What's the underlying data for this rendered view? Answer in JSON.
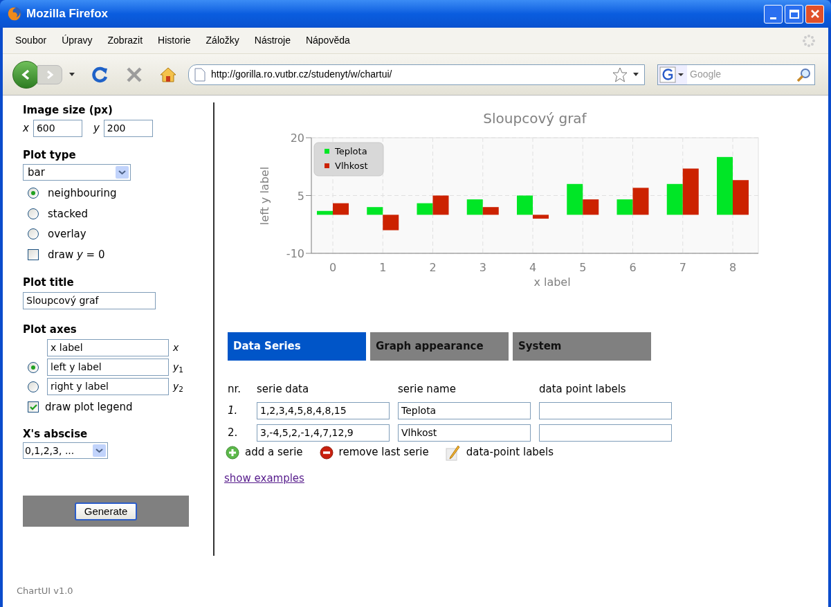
{
  "window": {
    "title": "Mozilla Firefox"
  },
  "menu": [
    "Soubor",
    "Úpravy",
    "Zobrazit",
    "Historie",
    "Záložky",
    "Nástroje",
    "Nápověda"
  ],
  "toolbar": {
    "url": "http://gorilla.ro.vutbr.cz/studenyt/w/chartui/",
    "search_placeholder": "Google"
  },
  "sidebar": {
    "image_size": {
      "heading": "Image size (px)",
      "x_label": "x",
      "x_value": "600",
      "y_label": "y",
      "y_value": "200"
    },
    "plot_type": {
      "heading": "Plot type",
      "select_value": "bar",
      "options": [
        {
          "label": "neighbouring",
          "selected": true
        },
        {
          "label": "stacked",
          "selected": false
        },
        {
          "label": "overlay",
          "selected": false
        }
      ],
      "draw_zero": {
        "label": "draw *y* = 0",
        "checked": false
      }
    },
    "plot_title": {
      "heading": "Plot title",
      "value": "Sloupcový graf"
    },
    "plot_axes": {
      "heading": "Plot axes",
      "fields": [
        {
          "kind": "plain",
          "value": "x label",
          "suffix": "*x*"
        },
        {
          "kind": "radio",
          "value": "left y label",
          "suffix": "*y*$_{1}$",
          "selected": true
        },
        {
          "kind": "radio",
          "value": "right y label",
          "suffix": "*y*$_{2}$",
          "selected": false
        }
      ],
      "legend": {
        "label": "draw plot legend",
        "checked": true
      }
    },
    "abscise": {
      "heading": "X's abscise",
      "value": "0,1,2,3, ..."
    },
    "generate": "Generate",
    "footer": "ChartUI v1.0"
  },
  "main": {
    "chart_data": {
      "type": "bar",
      "title": "Sloupcový graf",
      "xlabel": "x label",
      "ylabel": "left y label",
      "categories": [
        "0",
        "1",
        "2",
        "3",
        "4",
        "5",
        "6",
        "7",
        "8"
      ],
      "series": [
        {
          "name": "Teplota",
          "color": "#00e626",
          "values": [
            1,
            2,
            3,
            4,
            5,
            8,
            4,
            8,
            15
          ]
        },
        {
          "name": "Vlhkost",
          "color": "#cc2200",
          "values": [
            3,
            -4,
            5,
            2,
            -1,
            4,
            7,
            12,
            9
          ]
        }
      ],
      "ylim": [
        -10,
        20
      ],
      "yticks": [
        -10,
        5,
        20
      ],
      "grid": true,
      "legend": true
    },
    "tabs": [
      {
        "label": "Data Series",
        "selected": true
      },
      {
        "label": "Graph appearance",
        "selected": false
      },
      {
        "label": "System",
        "selected": false
      }
    ],
    "table": {
      "columns": [
        "nr.",
        "serie data",
        "serie name",
        "data point labels"
      ],
      "rows": [
        {
          "nr": "1.",
          "italic": true,
          "data": "1,2,3,4,5,8,4,8,15",
          "name": "Teplota"
        },
        {
          "nr": "2.",
          "italic": false,
          "data": "3,-4,5,2,-1,4,7,12,9",
          "name": "Vlhkost"
        }
      ]
    },
    "actions": [
      {
        "kind": "add",
        "label": "add a serie"
      },
      {
        "kind": "remove",
        "label": "remove last serie"
      },
      {
        "kind": "edit",
        "label": "data-point labels"
      }
    ],
    "link": "show examples"
  }
}
